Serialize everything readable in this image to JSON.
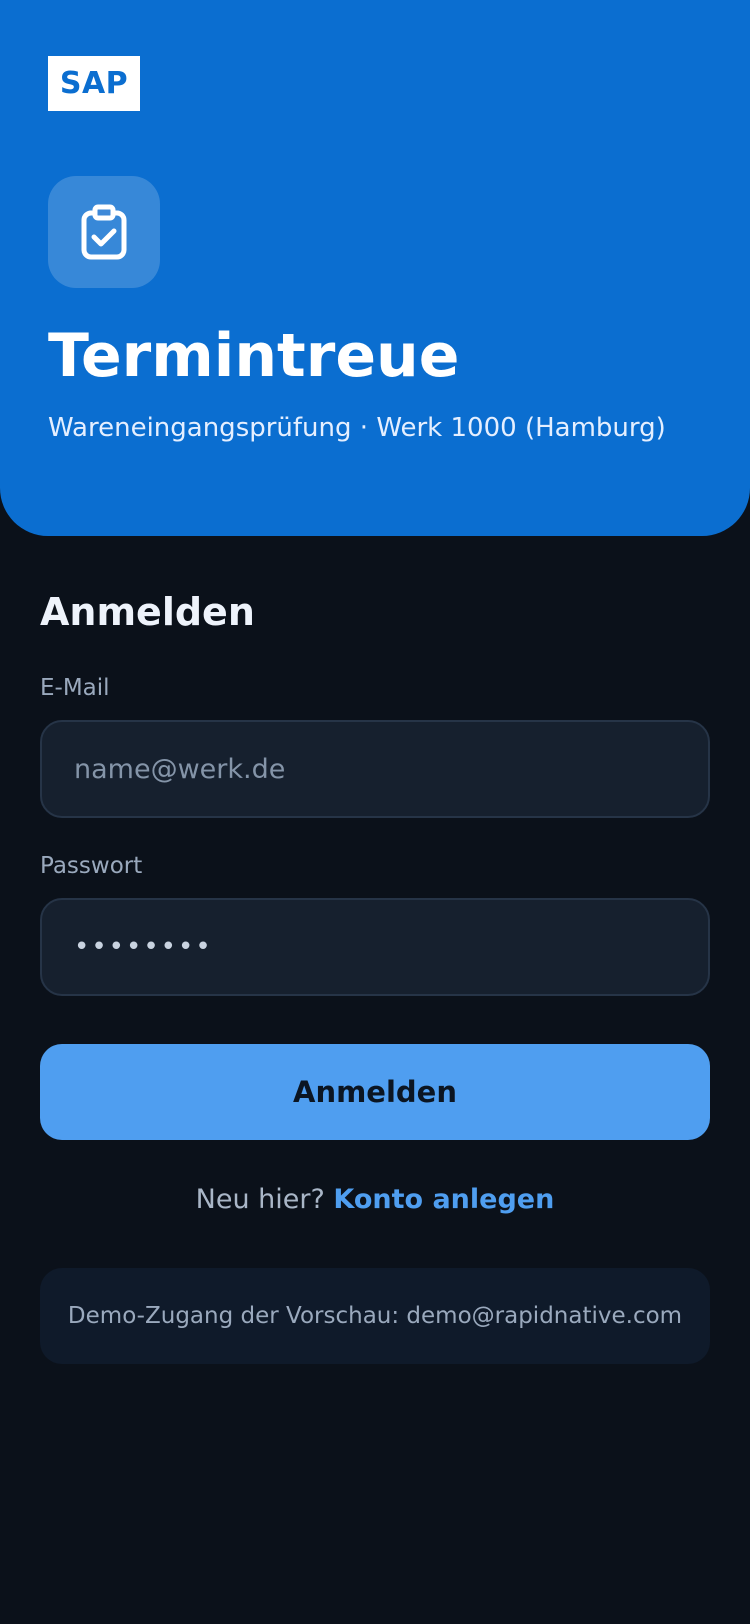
{
  "header": {
    "logo_text": "SAP",
    "app_icon": "clipboard-check-icon",
    "title": "Termintreue",
    "subtitle": "Wareneingangsprüfung · Werk 1000 (Hamburg)",
    "background_color": "#0b6ed0"
  },
  "login": {
    "heading": "Anmelden",
    "email_label": "E-Mail",
    "email_placeholder": "name@werk.de",
    "email_value": "",
    "password_label": "Passwort",
    "password_value": "••••••••",
    "submit_label": "Anmelden",
    "signup_prompt": "Neu hier?",
    "signup_link": "Konto anlegen",
    "demo_note": "Demo-Zugang der Vorschau: demo@rapidnative.com"
  },
  "theme": {
    "accent": "#4f9ef0",
    "background": "#0b111a",
    "field_background": "#16202e"
  }
}
